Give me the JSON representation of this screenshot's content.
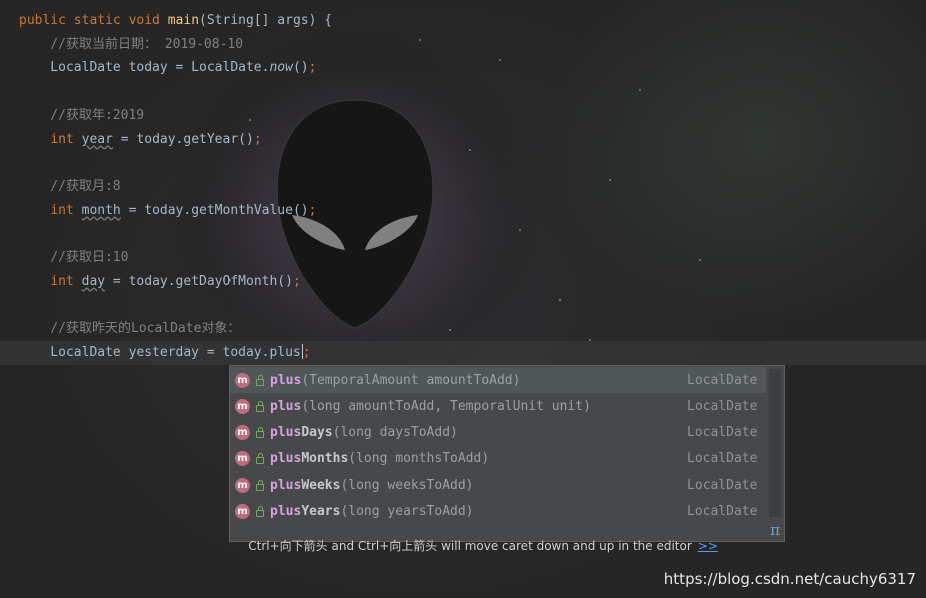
{
  "editor": {
    "lines": [
      {
        "segments": [
          {
            "text": "public static void ",
            "cls": "kw"
          },
          {
            "text": "main",
            "cls": "fn"
          },
          {
            "text": "(String[] args) {",
            "cls": ""
          }
        ]
      },
      {
        "segments": [
          {
            "text": "    //获取当前日期： 2019-08-10",
            "cls": "cm"
          }
        ]
      },
      {
        "segments": [
          {
            "text": "    LocalDate today = LocalDate.",
            "cls": ""
          },
          {
            "text": "now",
            "cls": "it"
          },
          {
            "text": "()",
            "cls": ""
          },
          {
            "text": ";",
            "cls": "semi"
          }
        ]
      },
      {
        "segments": []
      },
      {
        "segments": [
          {
            "text": "    //获取年:2019",
            "cls": "cm"
          }
        ]
      },
      {
        "segments": [
          {
            "text": "    ",
            "cls": ""
          },
          {
            "text": "int ",
            "cls": "kw"
          },
          {
            "text": "year",
            "cls": "warn"
          },
          {
            "text": " = today.getYear()",
            "cls": ""
          },
          {
            "text": ";",
            "cls": "semi"
          }
        ]
      },
      {
        "segments": []
      },
      {
        "segments": [
          {
            "text": "    //获取月:8",
            "cls": "cm"
          }
        ]
      },
      {
        "segments": [
          {
            "text": "    ",
            "cls": ""
          },
          {
            "text": "int ",
            "cls": "kw"
          },
          {
            "text": "month",
            "cls": "warn"
          },
          {
            "text": " = today.getMonthValue()",
            "cls": ""
          },
          {
            "text": ";",
            "cls": "semi"
          }
        ]
      },
      {
        "segments": []
      },
      {
        "segments": [
          {
            "text": "    //获取日:10",
            "cls": "cm"
          }
        ]
      },
      {
        "segments": [
          {
            "text": "    ",
            "cls": ""
          },
          {
            "text": "int ",
            "cls": "kw"
          },
          {
            "text": "day",
            "cls": "warn"
          },
          {
            "text": " = today.getDayOfMonth()",
            "cls": ""
          },
          {
            "text": ";",
            "cls": "semi"
          }
        ]
      },
      {
        "segments": []
      },
      {
        "segments": [
          {
            "text": "    //获取昨天的LocalDate对象：",
            "cls": "cm"
          }
        ]
      },
      {
        "segments": [
          {
            "text": "    LocalDate yesterday = today.plus",
            "cls": ""
          },
          {
            "text": ";",
            "cls": "semi"
          }
        ],
        "current": true
      }
    ]
  },
  "completion": {
    "items": [
      {
        "match": "plus",
        "rest": "",
        "params": "(TemporalAmount amountToAdd)",
        "type": "LocalDate",
        "badge": "m",
        "selected": true
      },
      {
        "match": "plus",
        "rest": "",
        "params": "(long amountToAdd, TemporalUnit unit)",
        "type": "LocalDate",
        "badge": "m"
      },
      {
        "match": "plus",
        "rest": "Days",
        "params": "(long daysToAdd)",
        "type": "LocalDate",
        "badge": "m"
      },
      {
        "match": "plus",
        "rest": "Months",
        "params": "(long monthsToAdd)",
        "type": "LocalDate",
        "badge": "m"
      },
      {
        "match": "plus",
        "rest": "Weeks",
        "params": "(long weeksToAdd)",
        "type": "LocalDate",
        "badge": "m"
      },
      {
        "match": "plus",
        "rest": "Years",
        "params": "(long yearsToAdd)",
        "type": "LocalDate",
        "badge": "m"
      }
    ],
    "hint": "Ctrl+向下箭头 and Ctrl+向上箭头 will move caret down and up in the editor",
    "more_link": ">>",
    "pi_symbol": "π"
  },
  "watermark": "https://blog.csdn.net/cauchy6317",
  "colors": {
    "keyword": "#cc7832",
    "method_decl": "#ffc66d",
    "comment": "#808080",
    "text": "#a9b7c6",
    "match_highlight": "#d7a2e0",
    "method_badge": "#c46a80"
  }
}
